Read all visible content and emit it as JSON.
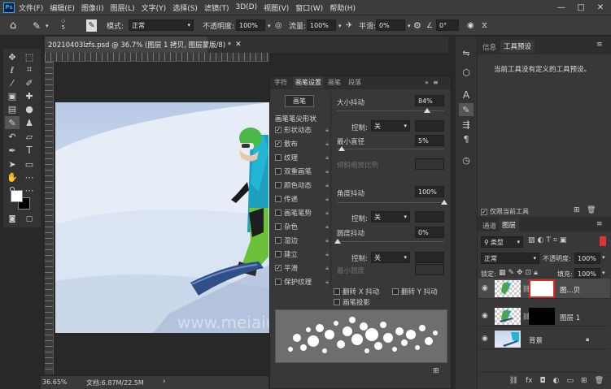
{
  "menubar": {
    "logo": "Ps",
    "items": [
      "文件(F)",
      "编辑(E)",
      "图像(I)",
      "图层(L)",
      "文字(Y)",
      "选择(S)",
      "滤镜(T)",
      "3D(D)",
      "视图(V)",
      "窗口(W)",
      "帮助(H)"
    ],
    "window_buttons": [
      "—",
      "□",
      "✕"
    ]
  },
  "options": {
    "brush_size": "5",
    "mode_label": "模式:",
    "mode_value": "正常",
    "opacity_label": "不透明度:",
    "opacity_value": "100%",
    "flow_label": "流量:",
    "flow_value": "100%",
    "smooth_label": "平滑:",
    "smooth_value": "0%",
    "angle_value": "0°"
  },
  "document": {
    "tab_title": "20210403lzfs.psd @ 36.7% (图层 1 拷贝, 图层蒙版/8) *",
    "zoom": "36.65%",
    "doc_info": "文档:6.87M/22.5M"
  },
  "brush_panel": {
    "tabs": [
      "字符",
      "画笔设置",
      "画笔",
      "段落"
    ],
    "brush_button": "画笔",
    "tip_shape": "画笔笔尖形状",
    "items": [
      {
        "label": "形状动态",
        "checked": true
      },
      {
        "label": "散布",
        "checked": true
      },
      {
        "label": "纹理",
        "checked": false
      },
      {
        "label": "双重画笔",
        "checked": false
      },
      {
        "label": "颜色动态",
        "checked": false
      },
      {
        "label": "传递",
        "checked": false
      },
      {
        "label": "画笔笔势",
        "checked": false
      },
      {
        "label": "杂色",
        "checked": false
      },
      {
        "label": "湿边",
        "checked": false
      },
      {
        "label": "建立",
        "checked": false
      },
      {
        "label": "平滑",
        "checked": true
      },
      {
        "label": "保护纹理",
        "checked": false
      }
    ],
    "size_jitter_label": "大小抖动",
    "size_jitter_value": "84%",
    "control_label": "控制:",
    "control_value": "关",
    "min_diameter_label": "最小直径",
    "min_diameter_value": "5%",
    "tilt_scale_label": "倾斜缩放比例",
    "angle_jitter_label": "角度抖动",
    "angle_jitter_value": "100%",
    "roundness_jitter_label": "圆度抖动",
    "roundness_jitter_value": "0%",
    "min_roundness_label": "最小圆度",
    "flip_x": "翻转 X 抖动",
    "flip_y": "翻转 Y 抖动",
    "brush_projection": "画笔投影"
  },
  "right_panel": {
    "tabs": [
      "信息",
      "工具预设"
    ],
    "no_preset_text": "当前工具没有定义的工具预设。",
    "current_tool_only": "仅限当前工具"
  },
  "layers_panel": {
    "tabs": [
      "通道",
      "图层"
    ],
    "filter": "类型",
    "blend_mode": "正常",
    "opacity_label": "不透明度:",
    "opacity_value": "100%",
    "lock_label": "锁定:",
    "fill_label": "填充:",
    "fill_value": "100%",
    "layers": [
      {
        "name": "图...贝"
      },
      {
        "name": "图层 1"
      },
      {
        "name": "背景"
      }
    ]
  },
  "watermark": "www.meiaiu.com",
  "colors": {
    "accent": "#31a8ff",
    "mask_highlight": "#e0281e"
  }
}
